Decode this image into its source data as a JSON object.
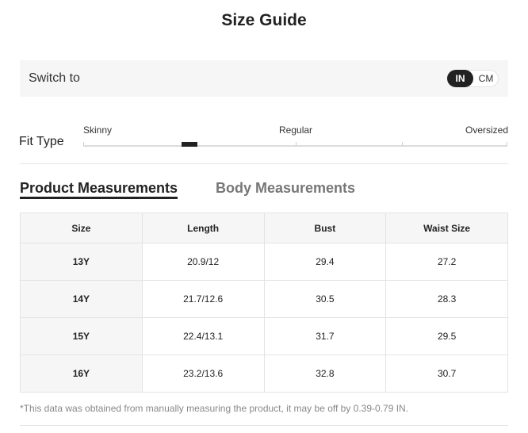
{
  "title": "Size Guide",
  "switch": {
    "label": "Switch to",
    "units": [
      "IN",
      "CM"
    ],
    "selected": "IN"
  },
  "fit": {
    "label": "Fit Type",
    "scale": [
      "Skinny",
      "Regular",
      "Oversized"
    ],
    "level": 0.25
  },
  "tabs": {
    "product": "Product Measurements",
    "body": "Body Measurements",
    "active": "Product Measurements"
  },
  "table": {
    "headers": [
      "Size",
      "Length",
      "Bust",
      "Waist Size"
    ],
    "rows": [
      [
        "13Y",
        "20.9/12",
        "29.4",
        "27.2"
      ],
      [
        "14Y",
        "21.7/12.6",
        "30.5",
        "28.3"
      ],
      [
        "15Y",
        "22.4/13.1",
        "31.7",
        "29.5"
      ],
      [
        "16Y",
        "23.2/13.6",
        "32.8",
        "30.7"
      ]
    ]
  },
  "note": "*This data was obtained from manually measuring the product, it may be off by 0.39-0.79 IN."
}
